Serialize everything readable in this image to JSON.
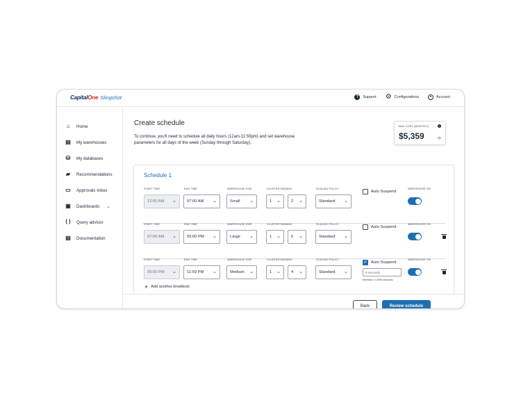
{
  "brand": {
    "logo": "Capital One",
    "logo_main": "Capital",
    "logo_tail": "One",
    "product": "Slingshot"
  },
  "topbar": {
    "support": "Support",
    "configurations": "Configurations",
    "account": "Account"
  },
  "sidebar": {
    "items": [
      {
        "label": "Home",
        "icon": "home-icon"
      },
      {
        "label": "My warehouses",
        "icon": "warehouse-icon"
      },
      {
        "label": "My databases",
        "icon": "database-icon"
      },
      {
        "label": "Recommendations",
        "icon": "recommendations-icon"
      },
      {
        "label": "Approvals Inbox",
        "icon": "inbox-icon"
      },
      {
        "label": "Dashboards",
        "icon": "dashboard-icon"
      },
      {
        "label": "Query advisor",
        "icon": "braces-icon"
      },
      {
        "label": "Documentation",
        "icon": "document-icon"
      }
    ]
  },
  "page": {
    "title": "Create schedule",
    "description": "To continue, you'll need to schedule all daily hours (12am-11:59pm) and set warehouse parameters for all days of the week (Sunday through Saturday)."
  },
  "max_cost": {
    "label": "MAX COST (MONTHLY)",
    "value": "$5,359"
  },
  "schedule": {
    "title": "Schedule 1",
    "labels": {
      "start_time": "START TIME",
      "end_time": "END TIME",
      "warehouse_size": "WAREHOUSE SIZE",
      "cluster": "CLUSTER MIN/MAX",
      "scaling_policy": "SCALING POLICY",
      "warehouse_on": "WAREHOUSE ON",
      "auto_suspend": "Auto Suspend"
    },
    "rows": [
      {
        "start": "12:00 AM",
        "end": "07:00 AM",
        "size": "Small",
        "cluster_min": "1",
        "cluster_max": "2",
        "policy": "Standard",
        "auto_suspend": false,
        "warehouse_on": true
      },
      {
        "start": "07:00 AM",
        "end": "05:00 PM",
        "size": "Large",
        "cluster_min": "1",
        "cluster_max": "6",
        "policy": "Standard",
        "auto_suspend": false,
        "warehouse_on": true
      },
      {
        "start": "05:00 PM",
        "end": "11:59 PM",
        "size": "Medium",
        "cluster_min": "1",
        "cluster_max": "4",
        "policy": "Standard",
        "auto_suspend": true,
        "warehouse_on": true,
        "suspend_placeholder": "5 seconds",
        "suspend_hint": "Min/Max: 0-1000 seconds"
      }
    ],
    "add_label": "Add another timeblock"
  },
  "footer": {
    "back": "Back",
    "review": "Review schedule"
  },
  "colors": {
    "accent": "#1f6fb0",
    "text": "#1f2733",
    "border": "#d6d9de"
  }
}
